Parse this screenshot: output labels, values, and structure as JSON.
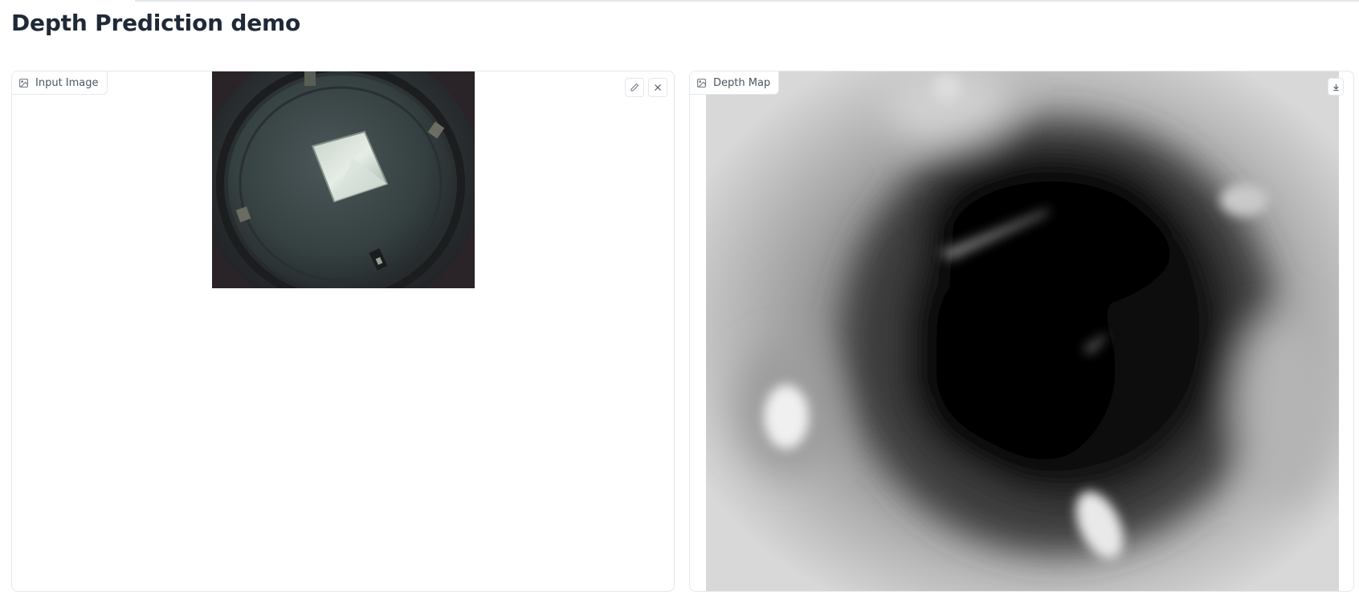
{
  "app": {
    "title": "Depth Prediction demo"
  },
  "input_panel": {
    "label": "Input Image",
    "label_icon": "image-icon",
    "actions": [
      {
        "name": "edit-icon",
        "title": "Edit"
      },
      {
        "name": "close-icon",
        "title": "Clear"
      }
    ]
  },
  "output_panel": {
    "label": "Depth Map",
    "label_icon": "image-icon",
    "actions": [
      {
        "name": "download-icon",
        "title": "Download"
      }
    ]
  },
  "colors": {
    "border": "#e5e7eb",
    "text": "#1f2937",
    "label_text": "#4b5563"
  }
}
